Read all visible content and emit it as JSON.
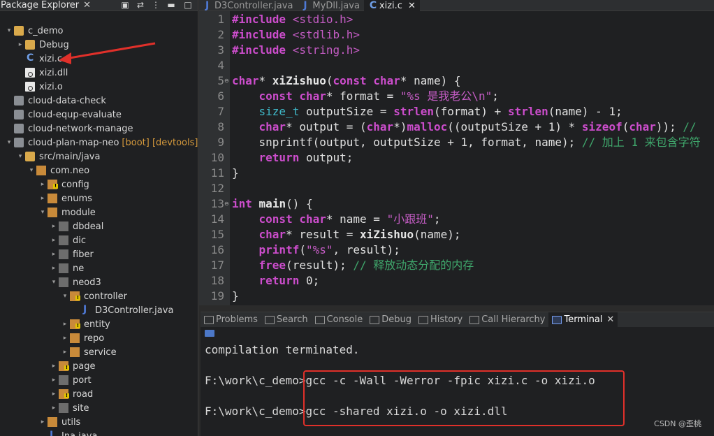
{
  "package_explorer": {
    "title": "Package Explorer",
    "tree": [
      {
        "label": "c_demo",
        "icon": "project-folder-icon",
        "level": 0,
        "expanded": true,
        "kind": "folder"
      },
      {
        "label": "Debug",
        "icon": "folder-icon",
        "level": 1,
        "expanded": false,
        "kind": "folder"
      },
      {
        "label": "xizi.c",
        "icon": "c-file-icon",
        "level": 1,
        "kind": "file-c"
      },
      {
        "label": "xizi.dll",
        "icon": "binary-file-icon",
        "level": 1,
        "kind": "file-bin"
      },
      {
        "label": "xizi.o",
        "icon": "binary-file-icon",
        "level": 1,
        "kind": "file-bin"
      },
      {
        "label": "cloud-data-check",
        "icon": "project-icon",
        "level": 0,
        "kind": "project"
      },
      {
        "label": "cloud-equp-evaluate",
        "icon": "project-icon",
        "level": 0,
        "kind": "project"
      },
      {
        "label": "cloud-network-manage",
        "icon": "project-icon",
        "level": 0,
        "kind": "project"
      },
      {
        "label": "cloud-plan-map-neo",
        "deco": "[boot] [devtools]",
        "icon": "maven-project-icon",
        "level": 0,
        "expanded": true,
        "kind": "project"
      },
      {
        "label": "src/main/java",
        "icon": "source-folder-icon",
        "level": 1,
        "expanded": true,
        "kind": "folder"
      },
      {
        "label": "com.neo",
        "icon": "package-icon",
        "level": 2,
        "expanded": true,
        "kind": "pkg"
      },
      {
        "label": "config",
        "icon": "package-icon",
        "level": 3,
        "expanded": false,
        "kind": "pkg-warn"
      },
      {
        "label": "enums",
        "icon": "package-icon",
        "level": 3,
        "expanded": false,
        "kind": "pkg"
      },
      {
        "label": "module",
        "icon": "package-icon",
        "level": 3,
        "expanded": true,
        "kind": "pkg"
      },
      {
        "label": "dbdeal",
        "icon": "package-icon",
        "level": 4,
        "expanded": false,
        "kind": "pkg-empty"
      },
      {
        "label": "dic",
        "icon": "package-icon",
        "level": 4,
        "expanded": false,
        "kind": "pkg-empty"
      },
      {
        "label": "fiber",
        "icon": "package-icon",
        "level": 4,
        "expanded": false,
        "kind": "pkg-empty"
      },
      {
        "label": "ne",
        "icon": "package-icon",
        "level": 4,
        "expanded": false,
        "kind": "pkg-empty"
      },
      {
        "label": "neod3",
        "icon": "package-icon",
        "level": 4,
        "expanded": true,
        "kind": "pkg-empty"
      },
      {
        "label": "controller",
        "icon": "package-icon",
        "level": 5,
        "expanded": true,
        "kind": "pkg-warn"
      },
      {
        "label": "D3Controller.java",
        "icon": "java-file-icon",
        "level": 6,
        "kind": "file-j"
      },
      {
        "label": "entity",
        "icon": "package-icon",
        "level": 5,
        "expanded": false,
        "kind": "pkg-warn"
      },
      {
        "label": "repo",
        "icon": "package-icon",
        "level": 5,
        "expanded": false,
        "kind": "pkg"
      },
      {
        "label": "service",
        "icon": "package-icon",
        "level": 5,
        "expanded": false,
        "kind": "pkg"
      },
      {
        "label": "page",
        "icon": "package-icon",
        "level": 4,
        "expanded": false,
        "kind": "pkg-warn"
      },
      {
        "label": "port",
        "icon": "package-icon",
        "level": 4,
        "expanded": false,
        "kind": "pkg-empty"
      },
      {
        "label": "road",
        "icon": "package-icon",
        "level": 4,
        "expanded": false,
        "kind": "pkg-warn"
      },
      {
        "label": "site",
        "icon": "package-icon",
        "level": 4,
        "expanded": false,
        "kind": "pkg-empty"
      },
      {
        "label": "utils",
        "icon": "package-icon",
        "level": 3,
        "expanded": false,
        "kind": "pkg"
      },
      {
        "label": "Jna.java",
        "icon": "java-file-icon",
        "level": 3,
        "kind": "file-j"
      }
    ]
  },
  "editor_tabs": [
    {
      "label": "D3Controller.java",
      "icon": "java-file-icon",
      "active": false
    },
    {
      "label": "MyDll.java",
      "icon": "java-file-icon",
      "active": false
    },
    {
      "label": "xizi.c",
      "icon": "c-file-icon",
      "active": true
    }
  ],
  "code_lines": [
    "#include <stdio.h>",
    "#include <stdlib.h>",
    "#include <string.h>",
    "",
    "char* xiZishuo(const char* name) {",
    "    const char* format = \"%s 是我老公\\n\";",
    "    size_t outputSize = strlen(format) + strlen(name) - 1;",
    "    char* output = (char*)malloc((outputSize + 1) * sizeof(char)); //",
    "    snprintf(output, outputSize + 1, format, name); // 加上 1 来包含字符",
    "    return output;",
    "}",
    "",
    "int main() {",
    "    const char* name = \"小跟班\";",
    "    char* result = xiZishuo(name);",
    "    printf(\"%s\", result);",
    "    free(result); // 释放动态分配的内存",
    "    return 0;",
    "}"
  ],
  "bottom_tabs": [
    {
      "label": "Problems",
      "icon": "problems-icon",
      "active": false
    },
    {
      "label": "Search",
      "icon": "search-icon",
      "active": false
    },
    {
      "label": "Console",
      "icon": "console-icon",
      "active": false
    },
    {
      "label": "Debug",
      "icon": "debug-icon",
      "active": false
    },
    {
      "label": "History",
      "icon": "history-icon",
      "active": false
    },
    {
      "label": "Call Hierarchy",
      "icon": "call-hierarchy-icon",
      "active": false
    },
    {
      "label": "Terminal",
      "icon": "terminal-icon",
      "active": true
    }
  ],
  "terminal": {
    "lines": [
      "compilation terminated.",
      "",
      "F:\\work\\c_demo>gcc -c -Wall -Werror -fpic xizi.c -o xizi.o",
      "",
      "F:\\work\\c_demo>gcc -shared xizi.o -o xizi.dll"
    ]
  },
  "watermark": "CSDN @歪桃",
  "colors": {
    "annotation_red": "#e0302a"
  }
}
